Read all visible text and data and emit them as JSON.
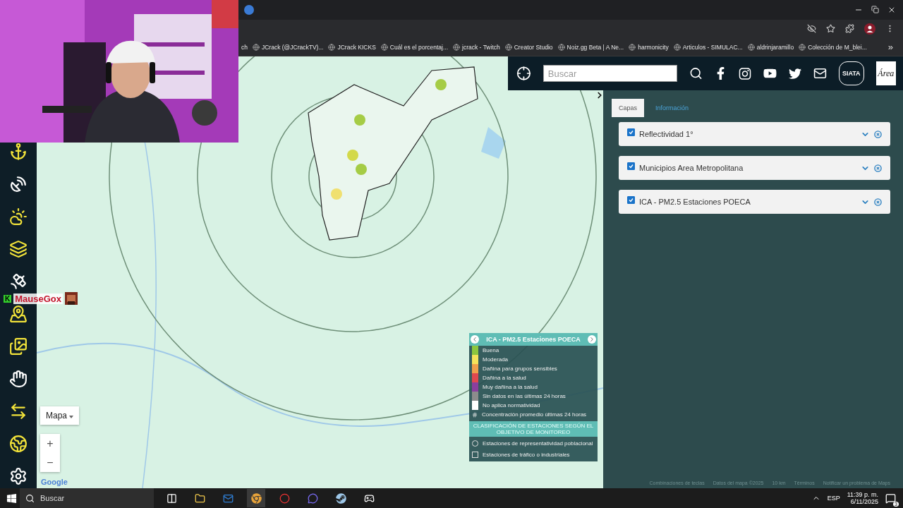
{
  "browser": {
    "bookmarks": [
      "ch",
      "JCrack (@JCrackTV)...",
      "JCrack KICKS",
      "Cuál es el porcentaj...",
      "jcrack - Twitch",
      "Creator Studio",
      "Noiz.gg Beta | A Ne...",
      "harmonicity",
      "Articulos - SIMULAC...",
      "aldrinjaramillo",
      "Colección de M_blei..."
    ],
    "more": "»"
  },
  "stream_overlay": {
    "badge": "K",
    "username": "MauseGox"
  },
  "header": {
    "search_placeholder": "Buscar",
    "logos": [
      "SIATA",
      "Área"
    ]
  },
  "tabs": [
    {
      "label": "Capas",
      "selected": true
    },
    {
      "label": "Información",
      "selected": false
    }
  ],
  "layers": [
    {
      "name": "Reflectividad 1°",
      "checked": true
    },
    {
      "name": "Municipios Area Metropolitana",
      "checked": true
    },
    {
      "name": "ICA - PM2.5 Estaciones POECA",
      "checked": true
    }
  ],
  "map": {
    "type_button": "Mapa",
    "zoom_in": "+",
    "zoom_out": "−",
    "attribution": "Google",
    "footer": [
      "Combinaciones de teclas",
      "Datos del mapa ©2025",
      "10 km",
      "Términos",
      "Notificar un problema de Maps"
    ]
  },
  "legend": {
    "title": "ICA - PM2.5 Estaciones POECA",
    "items": [
      {
        "label": "Buena",
        "color": "#8cc63f"
      },
      {
        "label": "Moderada",
        "color": "#f5e35a"
      },
      {
        "label": "Dañina para grupos sensibles",
        "color": "#f0a04b"
      },
      {
        "label": "Dañina a la salud",
        "color": "#e0484f"
      },
      {
        "label": "Muy dañina a la salud",
        "color": "#8a3f9e"
      },
      {
        "label": "Sin datos en las últimas 24 horas",
        "color": "#8c8c8c"
      },
      {
        "label": "No aplica normatividad",
        "color": "#ffffff"
      }
    ],
    "average": "Concentración promedio últimas 24 horas",
    "classification_title": "CLASIFICACIÓN DE ESTACIONES SEGÚN EL OBJETIVO DE MONITOREO",
    "stations": [
      {
        "label": "Estaciones de representatividad poblacional",
        "kind": "circle"
      },
      {
        "label": "Estaciones de tráfico o industriales",
        "kind": "square"
      }
    ]
  },
  "taskbar": {
    "search_placeholder": "Buscar",
    "language": "ESP",
    "time": "11:39 p. m.",
    "date": "6/11/2025",
    "notifications": "3"
  }
}
